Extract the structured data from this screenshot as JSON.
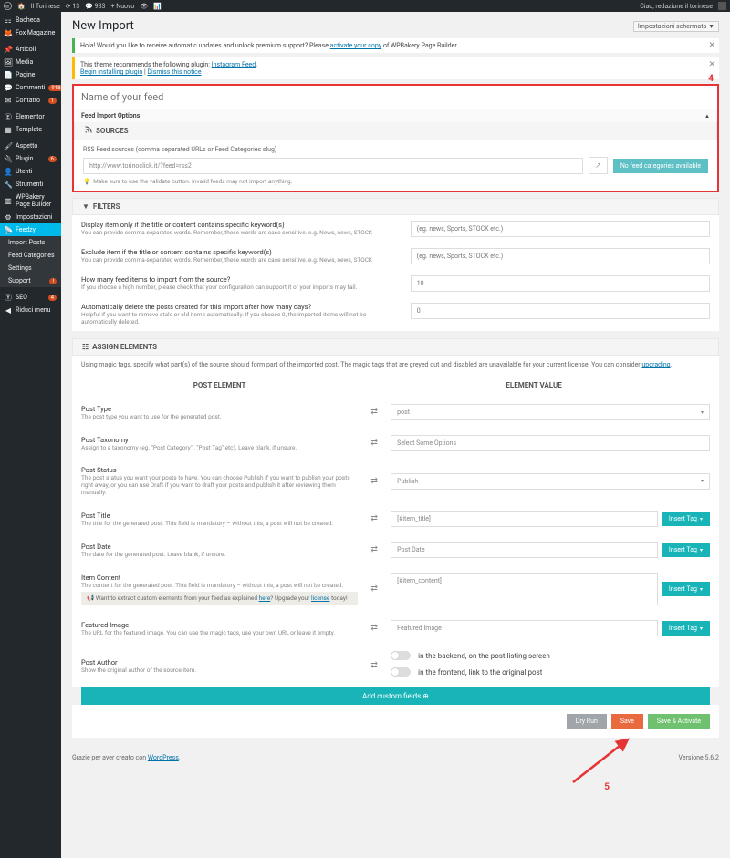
{
  "topbar": {
    "site": "Il Torinese",
    "comments": "13",
    "updates": "933",
    "new": "Nuovo",
    "greeting": "Ciao, redazione il torinese"
  },
  "sidebar": {
    "items": [
      {
        "label": "Bacheca"
      },
      {
        "label": "Fox Magazine"
      },
      {
        "label": "Articoli"
      },
      {
        "label": "Media"
      },
      {
        "label": "Pagine"
      },
      {
        "label": "Commenti",
        "badge": "918"
      },
      {
        "label": "Contatto",
        "badge": "1"
      },
      {
        "label": "Elementor"
      },
      {
        "label": "Template"
      },
      {
        "label": "Aspetto"
      },
      {
        "label": "Plugin",
        "badge": "6"
      },
      {
        "label": "Utenti"
      },
      {
        "label": "Strumenti"
      },
      {
        "label": "WPBakery Page Builder"
      },
      {
        "label": "Impostazioni"
      },
      {
        "label": "Feedzy",
        "active": true
      },
      {
        "label": "SEO",
        "badge": "4"
      },
      {
        "label": "Riduci menu"
      }
    ],
    "sub": [
      {
        "label": "Import Posts"
      },
      {
        "label": "Feed Categories"
      },
      {
        "label": "Settings"
      },
      {
        "label": "Support",
        "badge": "!"
      }
    ]
  },
  "page": {
    "title": "New Import",
    "screen_opts": "Impostazioni schermata"
  },
  "notices": {
    "premium": {
      "text": "Hola! Would you like to receive automatic updates and unlock premium support? Please ",
      "link": "activate your copy",
      "text2": " of WPBakery Page Builder."
    },
    "plugin": {
      "text": "This theme recommends the following plugin: ",
      "link": "Instagram Feed",
      "begin": "Begin installing plugin",
      "dismiss": "Dismiss this notice"
    }
  },
  "marker4": "4",
  "feed": {
    "name_placeholder": "Name of your feed",
    "options_label": "Feed Import Options"
  },
  "sources": {
    "title": "SOURCES",
    "help": "RSS Feed sources (comma separated URLs or Feed Categories slug)",
    "url": "http://www.torinoclick.it/?feed=rss2",
    "btn_no": "No feed categories available",
    "hint": "Make sure to use the validate button. Invalid feeds may not import anything."
  },
  "filters": {
    "title": "FILTERS",
    "rows": [
      {
        "t": "Display item only if the title or content contains specific keyword(s)",
        "h": "You can provide comma-separated words. Remember, these words are case sensitive. e.g. News, news, STOCK",
        "ph": "(eg. news, Sports, STOCK etc.)"
      },
      {
        "t": "Exclude item if the title or content contains specific keyword(s)",
        "h": "You can provide comma-separated words. Remember, these words are case sensitive. e.g. News, news, STOCK",
        "ph": "(eg. news, Sports, STOCK etc.)"
      },
      {
        "t": "How many feed items to import from the source?",
        "h": "If you choose a high number, please check that your configuration can support it or your imports may fail.",
        "ph": "10"
      },
      {
        "t": "Automatically delete the posts created for this import after how many days?",
        "h": "Helpful if you want to remove stale or old items automatically. If you choose 0, the imported items will not be automatically deleted.",
        "ph": "0"
      }
    ]
  },
  "assign": {
    "title": "ASSIGN ELEMENTS",
    "desc": "Using magic tags, specify what part(s) of the source should form part of the imported post. The magic tags that are greyed out and disabled are unavailable for your current license. You can consider ",
    "upgrade": "upgrading",
    "col1": "POST ELEMENT",
    "col2": "ELEMENT VALUE",
    "rows": [
      {
        "t": "Post Type",
        "h": "The post type you want to use for the generated post.",
        "type": "select",
        "val": "post"
      },
      {
        "t": "Post Taxonomy",
        "h": "Assign to a taxonomy (eg. \"Post Category\" , \"Post Tag\" etc). Leave blank, if unsure.",
        "type": "multi",
        "val": "Select Some Options"
      },
      {
        "t": "Post Status",
        "h": "The post status you want your posts to have. You can choose Publish if you want to publish your posts right away, or you can use Draft if you want to draft your posts and publish it after reviewing them manually.",
        "type": "select",
        "val": "Publish"
      },
      {
        "t": "Post Title",
        "h": "The title for the generated post. This field is mandatory – without this, a post will not be created.",
        "type": "text",
        "val": "[#item_title]",
        "tag": true
      },
      {
        "t": "Post Date",
        "h": "The date for the generated post. Leave blank, if unsure.",
        "type": "text",
        "val": "Post Date",
        "tag": true
      },
      {
        "t": "Item Content",
        "h": "The content for the generated post. This field is mandatory – without this, a post will not be created.",
        "type": "textarea",
        "val": "[#item_content]",
        "tag": true,
        "callout": true
      },
      {
        "t": "Featured Image",
        "h": "The URL for the featured image. You can use the magic tags, use your own URL or leave it empty.",
        "type": "text",
        "val": "Featured Image",
        "tag": true
      },
      {
        "t": "Post Author",
        "h": "Show the original author of the source item.",
        "type": "toggles"
      }
    ],
    "callout": {
      "pre": "Want to extract custom elements from your feed as explained ",
      "link1": "here",
      "mid": "? Upgrade your ",
      "link2": "license",
      "suf": " today!"
    },
    "toggles": [
      {
        "label": "in the backend, on the post listing screen"
      },
      {
        "label": "in the frontend, link to the original post"
      }
    ],
    "insert_tag": "Insert Tag",
    "add_fields": "Add custom fields"
  },
  "actions": {
    "dry": "Dry Run",
    "save": "Save",
    "activate": "Save & Activate"
  },
  "marker5": "5",
  "footer": {
    "left_pre": "Grazie per aver creato con ",
    "left_link": "WordPress",
    "right": "Versione 5.6.2"
  }
}
